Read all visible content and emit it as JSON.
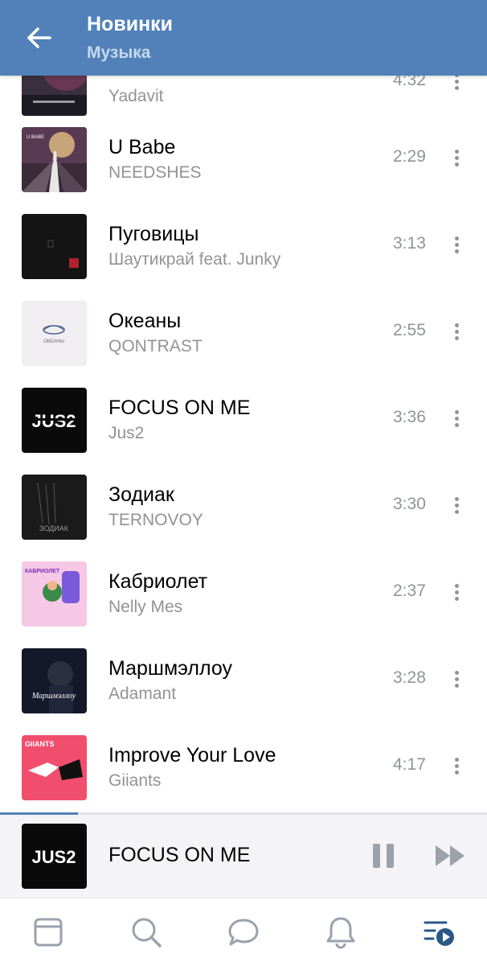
{
  "header": {
    "title": "Новинки",
    "subtitle": "Музыка"
  },
  "tracks": [
    {
      "title": "",
      "artist": "Yadavit",
      "duration": "4:32"
    },
    {
      "title": "U Babe",
      "artist": "NEEDSHES",
      "duration": "2:29"
    },
    {
      "title": "Пуговицы",
      "artist": "Шаутикрай feat. Junky",
      "duration": "3:13"
    },
    {
      "title": "Океаны",
      "artist": "QONTRAST",
      "duration": "2:55"
    },
    {
      "title": "FOCUS ON ME",
      "artist": "Jus2",
      "duration": "3:36"
    },
    {
      "title": "Зодиак",
      "artist": "TERNOVOY",
      "duration": "3:30"
    },
    {
      "title": "Кабриолет",
      "artist": "Nelly Mes",
      "duration": "2:37"
    },
    {
      "title": "Маршмэллоу",
      "artist": "Adamant",
      "duration": "3:28"
    },
    {
      "title": "Improve Your Love",
      "artist": "Giiants",
      "duration": "4:17"
    }
  ],
  "player": {
    "title": "FOCUS ON ME",
    "progress": 0.16,
    "cover_text": "JUS2"
  },
  "covers": {
    "focus_text": "JUS2",
    "zodiac_text": "ЗОДИАК",
    "cabriolet_text": "КАБРИОЛЕТ",
    "marsh_text": "Маршмэллоу",
    "giiants_text": "GIIANTS",
    "oceans_text": "ОКЕАНЫ",
    "ubabe_text": "U BABE"
  },
  "tabbar": {
    "tabs": [
      "feed-icon",
      "search-icon",
      "messages-icon",
      "notifications-icon",
      "music-icon"
    ],
    "active_color": "#2a5885",
    "inactive_color": "#99a2ad"
  },
  "colors": {
    "accent": "#5181b8",
    "secondary_text": "#939393"
  }
}
